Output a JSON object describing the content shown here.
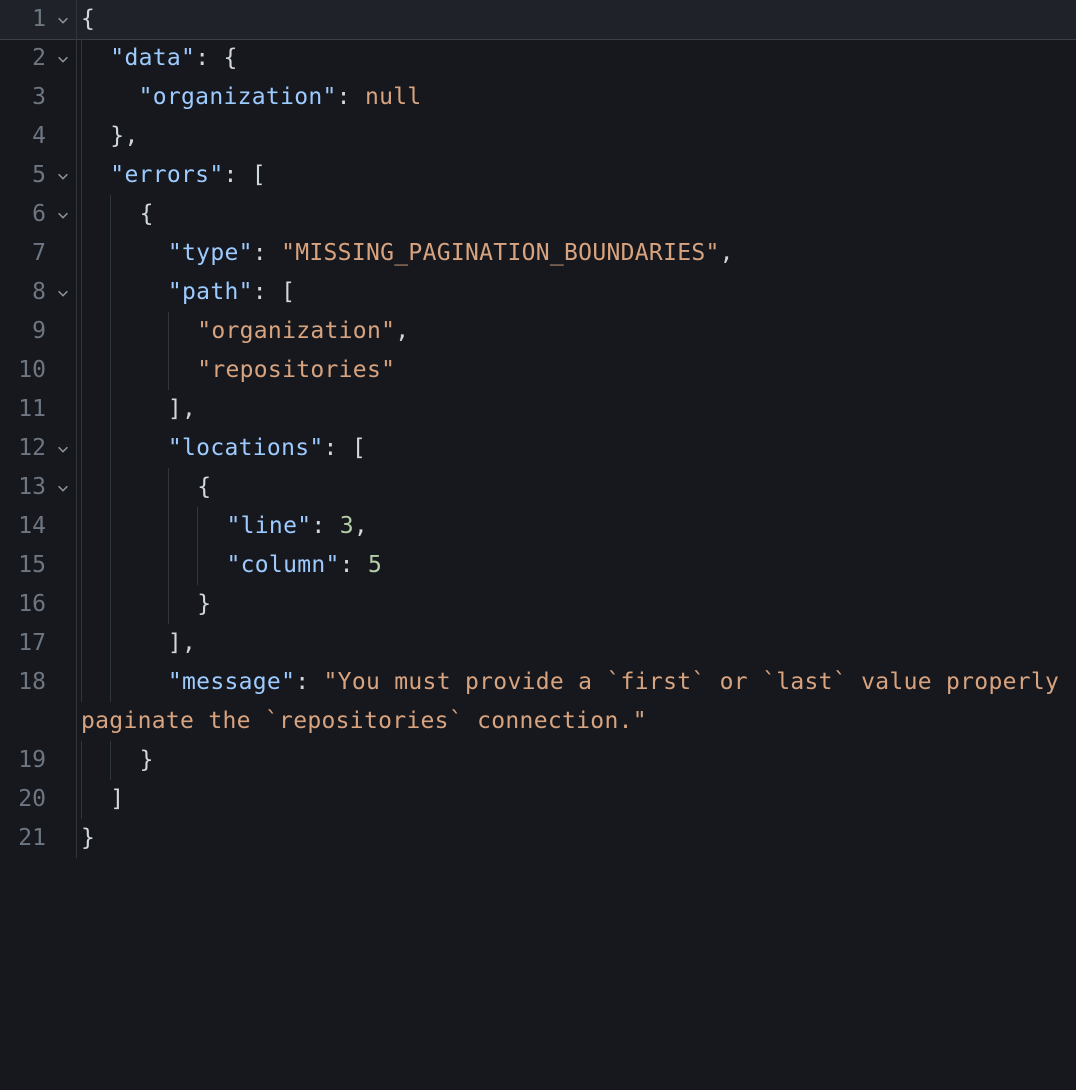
{
  "editor": {
    "lines": [
      {
        "num": "1",
        "fold": true
      },
      {
        "num": "2",
        "fold": true
      },
      {
        "num": "3",
        "fold": false
      },
      {
        "num": "4",
        "fold": false
      },
      {
        "num": "5",
        "fold": true
      },
      {
        "num": "6",
        "fold": true
      },
      {
        "num": "7",
        "fold": false
      },
      {
        "num": "8",
        "fold": true
      },
      {
        "num": "9",
        "fold": false
      },
      {
        "num": "10",
        "fold": false
      },
      {
        "num": "11",
        "fold": false
      },
      {
        "num": "12",
        "fold": true
      },
      {
        "num": "13",
        "fold": true
      },
      {
        "num": "14",
        "fold": false
      },
      {
        "num": "15",
        "fold": false
      },
      {
        "num": "16",
        "fold": false
      },
      {
        "num": "17",
        "fold": false
      },
      {
        "num": "18",
        "fold": false
      },
      {
        "num": "19",
        "fold": false
      },
      {
        "num": "20",
        "fold": false
      },
      {
        "num": "21",
        "fold": false
      }
    ],
    "tokens": {
      "brace_open": "{",
      "brace_close": "}",
      "bracket_open": "[",
      "bracket_close": "]",
      "colon": ":",
      "comma": ",",
      "k_data": "\"data\"",
      "k_organization": "\"organization\"",
      "v_null": "null",
      "k_errors": "\"errors\"",
      "k_type": "\"type\"",
      "v_type": "\"MISSING_PAGINATION_BOUNDARIES\"",
      "k_path": "\"path\"",
      "v_path0": "\"organization\"",
      "v_path1": "\"repositories\"",
      "k_locations": "\"locations\"",
      "k_line": "\"line\"",
      "v_line": "3",
      "k_column": "\"column\"",
      "v_column": "5",
      "k_message": "\"message\"",
      "v_message_a": "\"You must provide a `first` or `last` value ",
      "v_message_b": "properly paginate the `repositories` connection.\""
    }
  }
}
